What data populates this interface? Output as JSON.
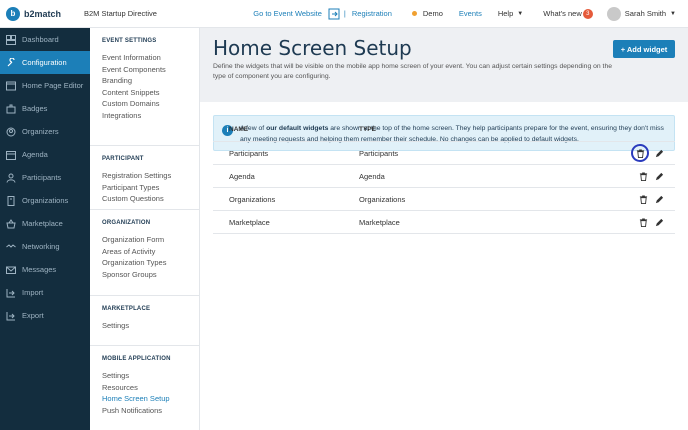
{
  "topbar": {
    "logo_text": "b2match",
    "event_name": "B2M Startup Directive",
    "go_to_event": "Go to Event Website",
    "separator": "|",
    "registration": "Registration",
    "demo": "Demo",
    "events": "Events",
    "help": "Help",
    "whats_new": "What's new",
    "whats_new_count": "3",
    "user_name": "Sarah Smith"
  },
  "sidebar": {
    "items": [
      {
        "label": "Dashboard",
        "icon": "dashboard-icon"
      },
      {
        "label": "Configuration",
        "icon": "wrench-icon",
        "active": true
      },
      {
        "label": "Home Page Editor",
        "icon": "page-editor-icon"
      },
      {
        "label": "Badges",
        "icon": "badge-icon"
      },
      {
        "label": "Organizers",
        "icon": "organizers-icon"
      },
      {
        "label": "Agenda",
        "icon": "agenda-icon"
      },
      {
        "label": "Participants",
        "icon": "participants-icon"
      },
      {
        "label": "Organizations",
        "icon": "organizations-icon"
      },
      {
        "label": "Marketplace",
        "icon": "marketplace-icon"
      },
      {
        "label": "Networking",
        "icon": "networking-icon"
      },
      {
        "label": "Messages",
        "icon": "messages-icon"
      },
      {
        "label": "Import",
        "icon": "import-icon"
      },
      {
        "label": "Export",
        "icon": "export-icon"
      }
    ]
  },
  "settings": {
    "sections": [
      {
        "heading": "EVENT SETTINGS",
        "items": [
          "Event Information",
          "Event Components",
          "Branding",
          "Content Snippets",
          "Custom Domains",
          "Integrations"
        ]
      },
      {
        "heading": "PARTICIPANT",
        "items": [
          "Registration Settings",
          "Participant Types",
          "Custom Questions"
        ]
      },
      {
        "heading": "ORGANIZATION",
        "items": [
          "Organization Form",
          "Areas of Activity",
          "Organization Types",
          "Sponsor Groups"
        ]
      },
      {
        "heading": "MARKETPLACE",
        "items": [
          "Settings"
        ]
      },
      {
        "heading": "MOBILE APPLICATION",
        "items": [
          "Settings",
          "Resources",
          "Home Screen Setup",
          "Push Notifications"
        ]
      }
    ]
  },
  "main": {
    "title": "Home Screen Setup",
    "description": "Define the widgets that will be visible on the mobile app home screen of your event. You can adjust certain settings depending on the type of component you are configuring.",
    "add_button": "+ Add widget",
    "info_prefix": "A few of ",
    "info_bold": "our default widgets",
    "info_rest": " are shown at the top of the home screen. They help participants prepare for the event, ensuring they don't miss any meeting requests and helping them remember their schedule. No changes can be applied to default widgets.",
    "table": {
      "headers": {
        "name": "NAME",
        "type": "TYPE"
      },
      "rows": [
        {
          "name": "Participants",
          "type": "Participants"
        },
        {
          "name": "Agenda",
          "type": "Agenda"
        },
        {
          "name": "Organizations",
          "type": "Organizations"
        },
        {
          "name": "Marketplace",
          "type": "Marketplace"
        }
      ]
    }
  },
  "colors": {
    "accent": "#1c7fb8",
    "sidebar_bg": "#132d3e",
    "highlight_ring": "#2a3bbd"
  }
}
